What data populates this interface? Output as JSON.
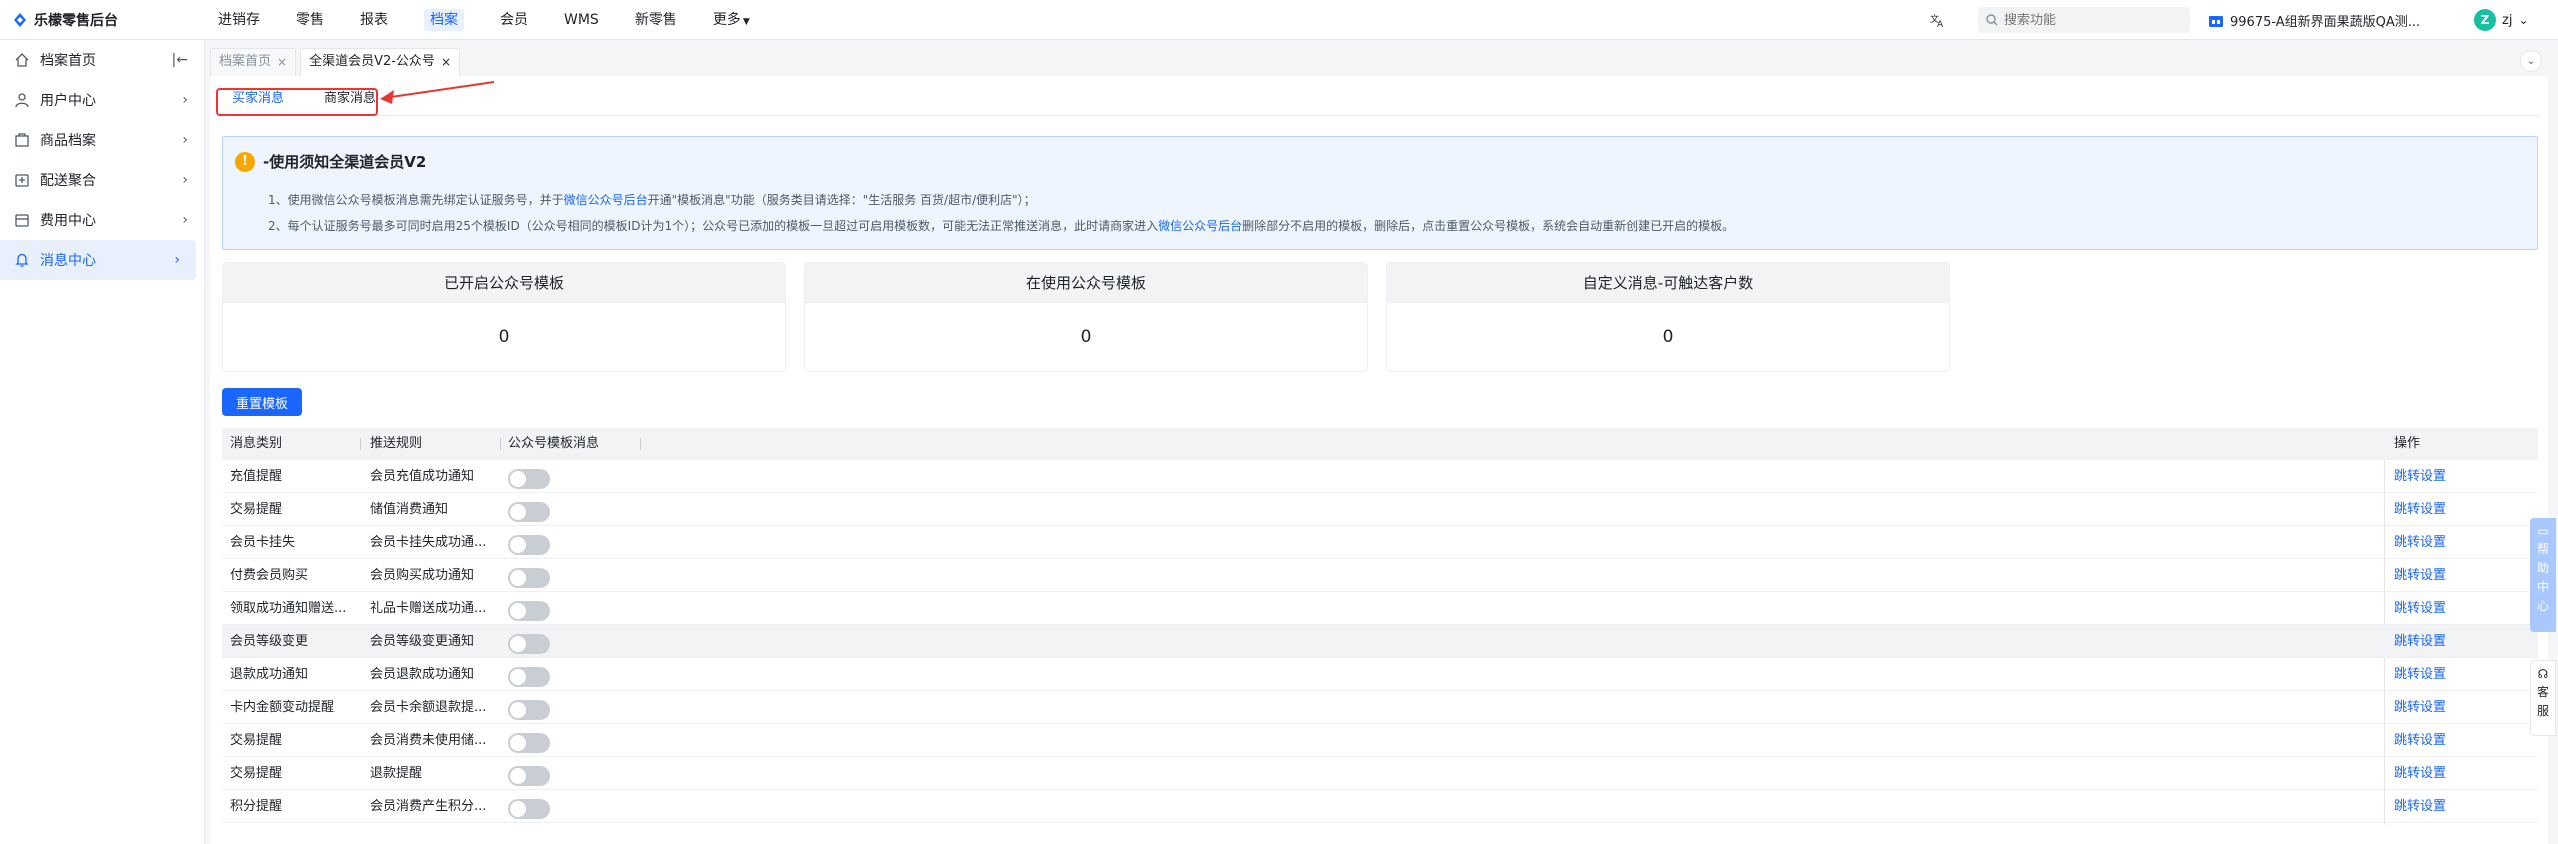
{
  "app": {
    "title": "乐檬零售后台"
  },
  "nav": {
    "items": [
      {
        "label": "进销存"
      },
      {
        "label": "零售"
      },
      {
        "label": "报表"
      },
      {
        "label": "档案"
      },
      {
        "label": "会员"
      },
      {
        "label": "WMS"
      },
      {
        "label": "新零售"
      },
      {
        "label": "更多"
      }
    ],
    "active_index": 3
  },
  "header": {
    "search_placeholder": "搜索功能",
    "store_name": "99675-A组新界面果蔬版QA测...",
    "user_initial": "Z",
    "user_name": "zj"
  },
  "sidebar": {
    "items": [
      {
        "label": "档案首页",
        "icon": "home-icon"
      },
      {
        "label": "用户中心",
        "icon": "user-icon"
      },
      {
        "label": "商品档案",
        "icon": "goods-icon"
      },
      {
        "label": "配送聚合",
        "icon": "delivery-icon"
      },
      {
        "label": "费用中心",
        "icon": "fee-icon"
      },
      {
        "label": "消息中心",
        "icon": "bell-icon"
      }
    ],
    "active_index": 5
  },
  "page_tabs": [
    {
      "label": "档案首页",
      "close": "×"
    },
    {
      "label": "全渠道会员V2-公众号",
      "close": "×"
    }
  ],
  "sub_tabs": [
    {
      "label": "买家消息"
    },
    {
      "label": "商家消息"
    }
  ],
  "notice": {
    "title": "-使用须知全渠道会员V2",
    "line1_a": "1、使用微信公众号模板消息需先绑定认证服务号，并于",
    "line1_link": "微信公众号后台",
    "line1_b": "开通\"模板消息\"功能（服务类目请选择：\"生活服务 百货/超市/便利店\"）；",
    "line2_a": "2、每个认证服务号最多可同时启用25个模板ID（公众号相同的模板ID计为1个）；公众号已添加的模板一旦超过可启用模板数，可能无法正常推送消息，此时请商家进入",
    "line2_link": "微信公众号后台",
    "line2_b": "删除部分不启用的模板，删除后，点击重置公众号模板，系统会自动重新创建已开启的模板。"
  },
  "stats": [
    {
      "label": "已开启公众号模板",
      "value": "0"
    },
    {
      "label": "在使用公众号模板",
      "value": "0"
    },
    {
      "label": "自定义消息-可触达客户数",
      "value": "0"
    }
  ],
  "reset_button": "重置模板",
  "table": {
    "columns": [
      "消息类别",
      "推送规则",
      "公众号模板消息",
      "操作"
    ],
    "rows": [
      {
        "type": "充值提醒",
        "rule": "会员充值成功通知",
        "enabled": false,
        "action": "跳转设置"
      },
      {
        "type": "交易提醒",
        "rule": "储值消费通知",
        "enabled": false,
        "action": "跳转设置"
      },
      {
        "type": "会员卡挂失",
        "rule": "会员卡挂失成功通...",
        "enabled": false,
        "action": "跳转设置"
      },
      {
        "type": "付费会员购买",
        "rule": "会员购买成功通知",
        "enabled": false,
        "action": "跳转设置"
      },
      {
        "type": "领取成功通知赠送...",
        "rule": "礼品卡赠送成功通...",
        "enabled": false,
        "action": "跳转设置"
      },
      {
        "type": "会员等级变更",
        "rule": "会员等级变更通知",
        "enabled": false,
        "action": "跳转设置"
      },
      {
        "type": "退款成功通知",
        "rule": "会员退款成功通知",
        "enabled": false,
        "action": "跳转设置"
      },
      {
        "type": "卡内金额变动提醒",
        "rule": "会员卡余额退款提...",
        "enabled": false,
        "action": "跳转设置"
      },
      {
        "type": "交易提醒",
        "rule": "会员消费未使用储...",
        "enabled": false,
        "action": "跳转设置"
      },
      {
        "type": "交易提醒",
        "rule": "退款提醒",
        "enabled": false,
        "action": "跳转设置"
      },
      {
        "type": "积分提醒",
        "rule": "会员消费产生积分...",
        "enabled": false,
        "action": "跳转设置"
      }
    ]
  },
  "float": {
    "help": [
      "帮",
      "助",
      "中",
      "心"
    ],
    "service": [
      "客",
      "服"
    ]
  },
  "colors": {
    "accent": "#1a66ff",
    "annotation": "#e53935",
    "warning": "#f7a800"
  }
}
